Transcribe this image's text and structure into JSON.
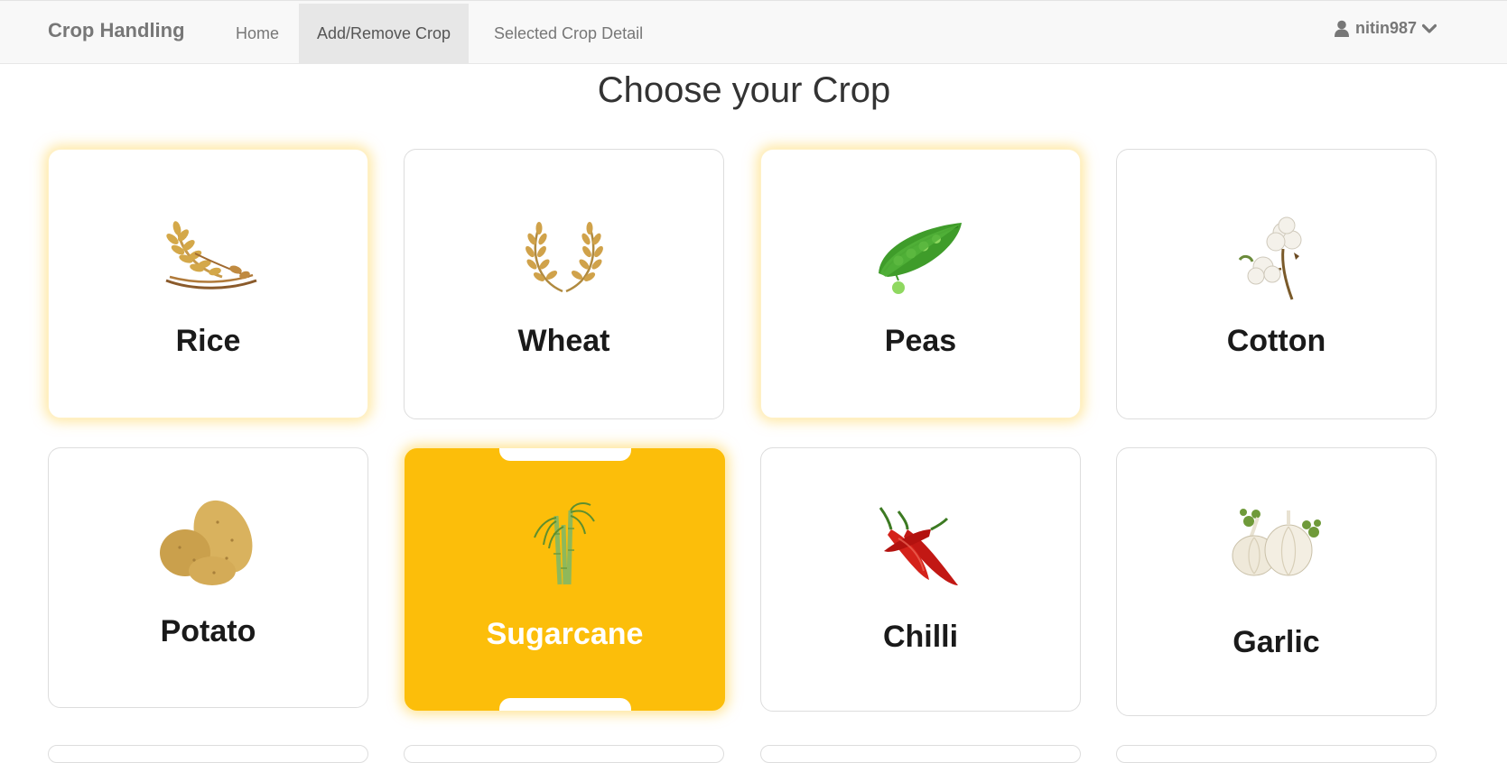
{
  "navbar": {
    "brand": "Crop Handling",
    "links": [
      {
        "label": "Home",
        "active": false
      },
      {
        "label": "Add/Remove Crop",
        "active": true
      },
      {
        "label": "Selected Crop Detail",
        "active": false
      }
    ],
    "user": {
      "username": "nitin987",
      "icon": "user-icon",
      "caret": "chevron-down-icon"
    }
  },
  "page": {
    "title": "Choose your Crop"
  },
  "crops": [
    {
      "name": "Rice",
      "icon": "rice-icon",
      "state": "highlighted"
    },
    {
      "name": "Wheat",
      "icon": "wheat-icon",
      "state": "normal"
    },
    {
      "name": "Peas",
      "icon": "peas-icon",
      "state": "highlighted"
    },
    {
      "name": "Cotton",
      "icon": "cotton-icon",
      "state": "normal"
    },
    {
      "name": "Potato",
      "icon": "potato-icon",
      "state": "normal"
    },
    {
      "name": "Sugarcane",
      "icon": "sugarcane-icon",
      "state": "selected"
    },
    {
      "name": "Chilli",
      "icon": "chilli-icon",
      "state": "normal"
    },
    {
      "name": "Garlic",
      "icon": "garlic-icon",
      "state": "normal"
    }
  ],
  "colors": {
    "selected_bg": "#fcbe0a",
    "highlight_glow": "#ffd65a",
    "navbar_bg": "#f8f8f8",
    "active_tab_bg": "#e7e7e7"
  }
}
